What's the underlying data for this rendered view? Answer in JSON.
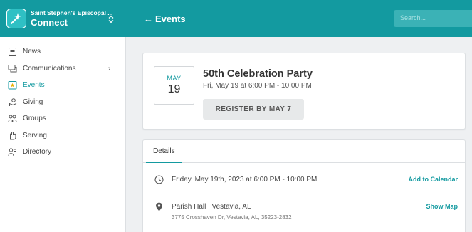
{
  "header": {
    "church_name": "Saint Stephen's Episcopal ...",
    "app_name": "Connect",
    "back_label": "Events",
    "search_placeholder": "Search..."
  },
  "colors": {
    "brand": "#139aa0",
    "brand_light": "#2fc0c4"
  },
  "sidebar": {
    "items": [
      {
        "label": "News",
        "icon": "newspaper-icon"
      },
      {
        "label": "Communications",
        "icon": "chat-icon",
        "has_submenu": true
      },
      {
        "label": "Events",
        "icon": "calendar-star-icon",
        "active": true
      },
      {
        "label": "Giving",
        "icon": "giving-hand-icon"
      },
      {
        "label": "Groups",
        "icon": "people-icon"
      },
      {
        "label": "Serving",
        "icon": "serving-hand-icon"
      },
      {
        "label": "Directory",
        "icon": "directory-icon"
      }
    ]
  },
  "event": {
    "month": "MAY",
    "day": "19",
    "title": "50th Celebration Party",
    "time": "Fri, May 19 at 6:00 PM - 10:00 PM",
    "register_label": "REGISTER BY MAY 7"
  },
  "details": {
    "tab_label": "Details",
    "datetime": "Friday, May 19th, 2023 at 6:00 PM - 10:00 PM",
    "calendar_link": "Add to Calendar",
    "location": "Parish Hall | Vestavia, AL",
    "address": "3775 Crosshaven Dr, Vestavia, AL, 35223-2832",
    "map_link": "Show Map"
  }
}
